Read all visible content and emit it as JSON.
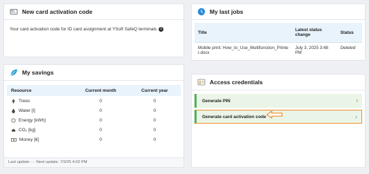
{
  "activation_card": {
    "title": "New card activation code",
    "text": "Your card activation code for ID card assignment at YSoft SafeQ terminals",
    "info_icon": "info-icon"
  },
  "jobs_card": {
    "title": "My last jobs",
    "columns": [
      "Title",
      "Latest status change",
      "Status"
    ],
    "rows": [
      {
        "title": "Mobile print: How_to_Use_Multifunction_Printer.docx",
        "date": "July 3, 2025 3:48 PM",
        "status": "Deleted"
      }
    ]
  },
  "savings_card": {
    "title": "My savings",
    "columns": [
      "Resource",
      "Current month",
      "Current year"
    ],
    "rows": [
      {
        "icon": "tree-icon",
        "resource": "Trees",
        "month": "0",
        "year": "0"
      },
      {
        "icon": "water-drop-icon",
        "resource": "Water [l]",
        "month": "0",
        "year": "0"
      },
      {
        "icon": "energy-icon",
        "resource": "Energy [kWh]",
        "month": "0",
        "year": "0"
      },
      {
        "icon": "co2-cloud-icon",
        "resource": "CO₂ [kg]",
        "month": "0",
        "year": "0"
      },
      {
        "icon": "money-icon",
        "resource": "Money [€]",
        "month": "0",
        "year": "0"
      }
    ],
    "footer": "Last update: - · Next update: 7/3/25 4:02 PM"
  },
  "access_card": {
    "title": "Access credentials",
    "items": [
      "Generate PIN",
      "Generate card activation code"
    ]
  },
  "colors": {
    "accent_green": "#4caf50",
    "highlight_orange": "#f08a2a",
    "header_blue": "#e9f3fb"
  }
}
